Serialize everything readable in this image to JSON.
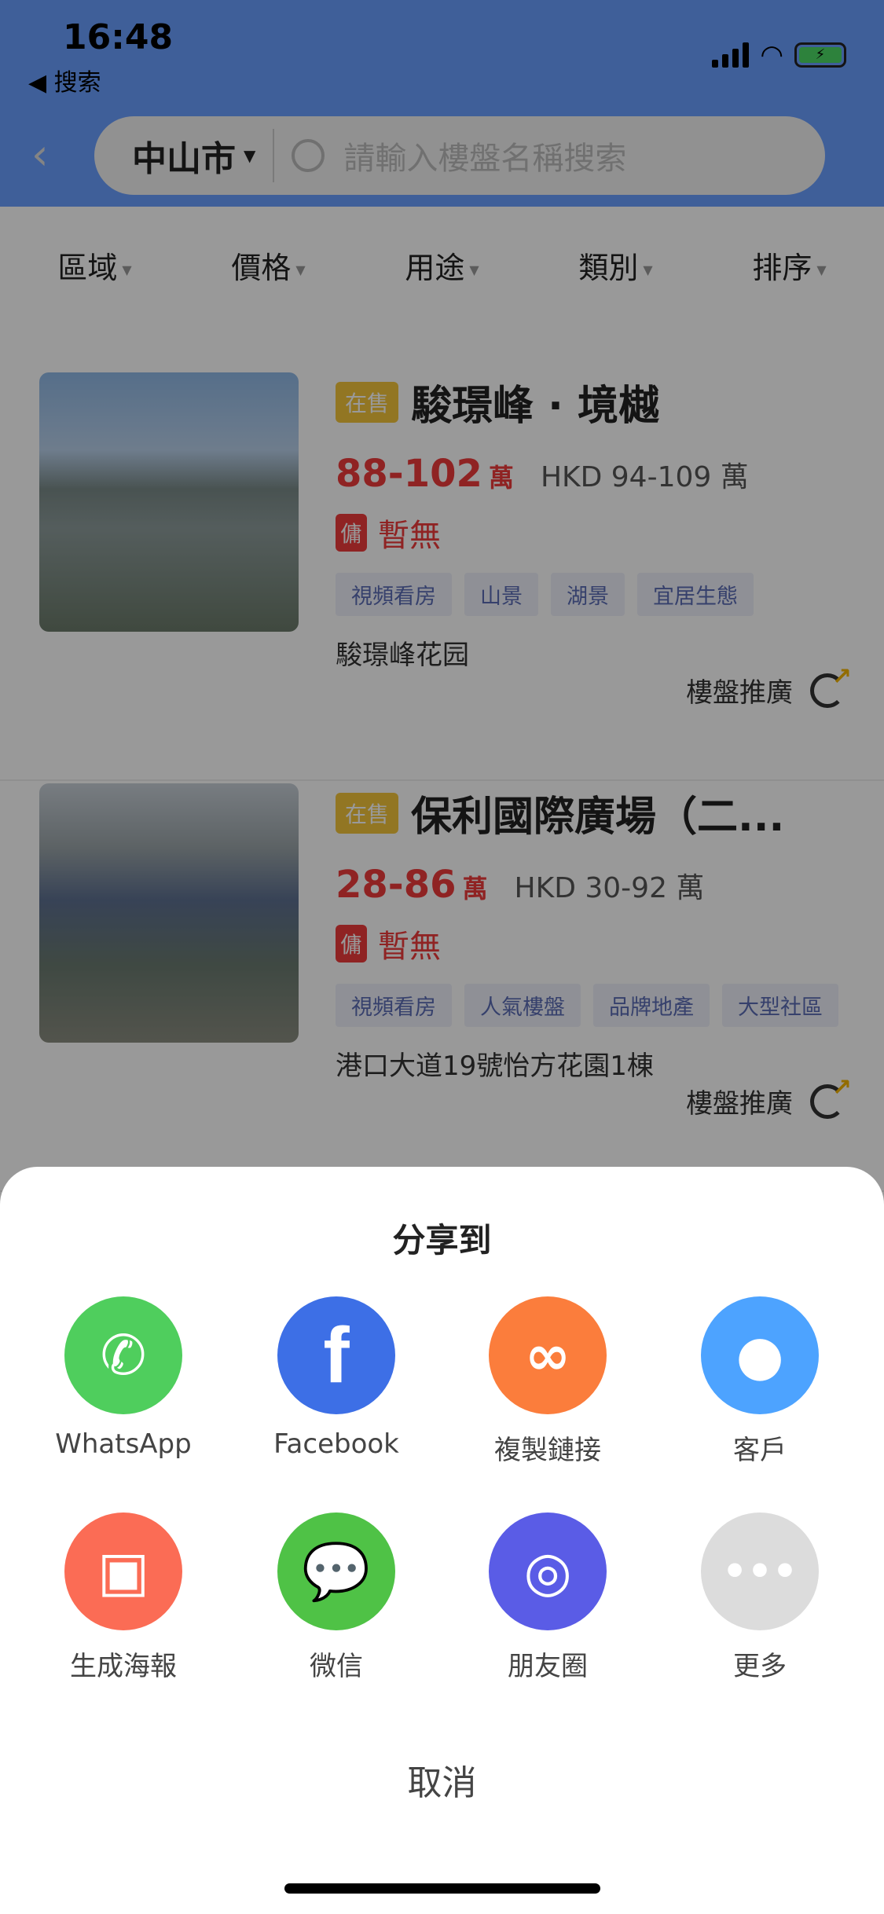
{
  "status_bar": {
    "time": "16:48",
    "back_app": "◀ 搜索"
  },
  "header": {
    "city": "中山市",
    "search_placeholder": "請輸入樓盤名稱搜索"
  },
  "filters": [
    "區域",
    "價格",
    "用途",
    "類別",
    "排序"
  ],
  "listings": [
    {
      "status": "在售",
      "title": "駿璟峰 · 境樾",
      "price": "88-102",
      "unit": "萬",
      "hkd": "HKD 94-109 萬",
      "commission_badge": "傭",
      "commission": "暫無",
      "tags": [
        "視頻看房",
        "山景",
        "湖景",
        "宜居生態"
      ],
      "address": "駿璟峰花园",
      "promo": "樓盤推廣"
    },
    {
      "status": "在售",
      "title": "保利國際廣場（二...",
      "price": "28-86",
      "unit": "萬",
      "hkd": "HKD 30-92 萬",
      "commission_badge": "傭",
      "commission": "暫無",
      "tags": [
        "視頻看房",
        "人氣樓盤",
        "品牌地產",
        "大型社區"
      ],
      "address": "港口大道19號怡方花園1棟",
      "promo": "樓盤推廣"
    }
  ],
  "share_sheet": {
    "title": "分享到",
    "options": [
      {
        "label": "WhatsApp",
        "icon": "whatsapp-icon",
        "color": "#4fce5d"
      },
      {
        "label": "Facebook",
        "icon": "facebook-icon",
        "color": "#3d6fe6"
      },
      {
        "label": "複製鏈接",
        "icon": "link-icon",
        "color": "#fb7d3c"
      },
      {
        "label": "客戶",
        "icon": "user-icon",
        "color": "#4da3ff"
      },
      {
        "label": "生成海報",
        "icon": "image-icon",
        "color": "#fb6c55"
      },
      {
        "label": "微信",
        "icon": "wechat-icon",
        "color": "#4fc246"
      },
      {
        "label": "朋友圈",
        "icon": "moments-icon",
        "color": "#5a5ce6"
      },
      {
        "label": "更多",
        "icon": "more-icon",
        "color": "#dcdcdc"
      }
    ],
    "cancel": "取消"
  }
}
